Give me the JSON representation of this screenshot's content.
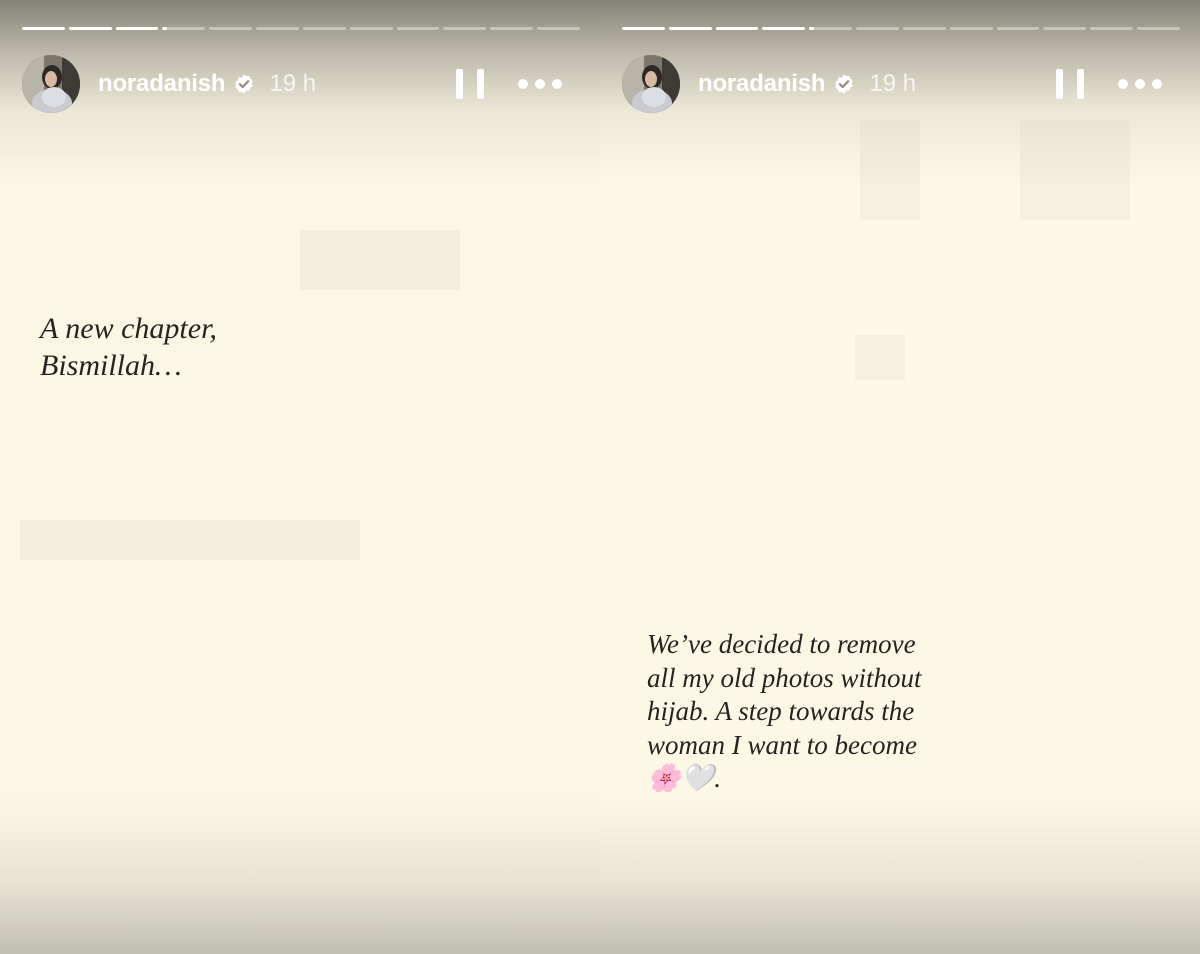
{
  "stories": [
    {
      "progress": {
        "segments": 12,
        "completed": 3,
        "current_fill": 0.1
      },
      "author": {
        "username": "noradanish",
        "verified": true,
        "avatar": "profile-photo",
        "time_ago": "19 h"
      },
      "controls": {
        "pause_icon": "pause-icon",
        "more_icon": "more-options-icon"
      },
      "caption": "A new chapter,\nBismillah…"
    },
    {
      "progress": {
        "segments": 12,
        "completed": 4,
        "current_fill": 0.1
      },
      "author": {
        "username": "noradanish",
        "verified": true,
        "avatar": "profile-photo",
        "time_ago": "19 h"
      },
      "controls": {
        "pause_icon": "pause-icon",
        "more_icon": "more-options-icon"
      },
      "caption": "We’ve decided to remove\nall my old photos without\nhijab. A step towards the\nwoman I want to become\n🌸🤍."
    }
  ],
  "colors": {
    "background": "#fcf7e5",
    "caption_text": "#262320",
    "header_text": "#ffffff",
    "verified_badge": "#ffffff"
  }
}
